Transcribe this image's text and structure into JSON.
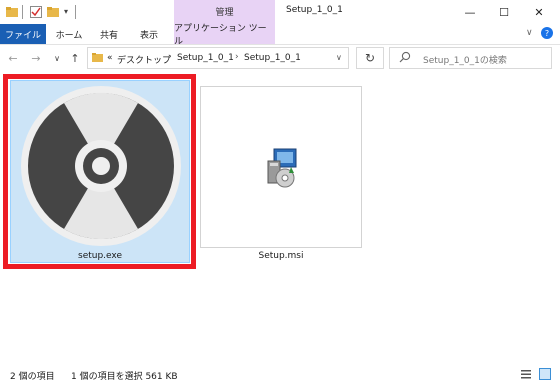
{
  "title_bar": {
    "manage_tab": "管理",
    "window_title": "Setup_1_0_1",
    "minimize_glyph": "—",
    "maximize_glyph": "☐",
    "close_glyph": "✕"
  },
  "ribbon": {
    "tabs": [
      "ファイル",
      "ホーム",
      "共有",
      "表示",
      "アプリケーション ツール"
    ],
    "collapse_glyph": "∨",
    "help_glyph": "?"
  },
  "nav": {
    "back_glyph": "←",
    "forward_glyph": "→",
    "recent_glyph": "∨",
    "up_glyph": "↑",
    "overflow": "«",
    "breadcrumb": [
      "デスクトップ",
      "Setup_1_0_1",
      "Setup_1_0_1"
    ],
    "separator": "›",
    "dropdown_glyph": "∨",
    "refresh_glyph": "↻"
  },
  "search": {
    "placeholder": "Setup_1_0_1の検索"
  },
  "files": [
    {
      "name": "setup.exe",
      "icon": "disc-icon",
      "selected": true
    },
    {
      "name": "Setup.msi",
      "icon": "installer-icon",
      "selected": false
    }
  ],
  "status": {
    "item_count": "2 個の項目",
    "selection": "1 個の項目を選択  561 KB"
  },
  "colors": {
    "file_tab": "#1a5fb4",
    "manage_tab": "#e8d3f5",
    "selection_fill": "#cce4f7",
    "highlight_border": "#ed1c24"
  }
}
